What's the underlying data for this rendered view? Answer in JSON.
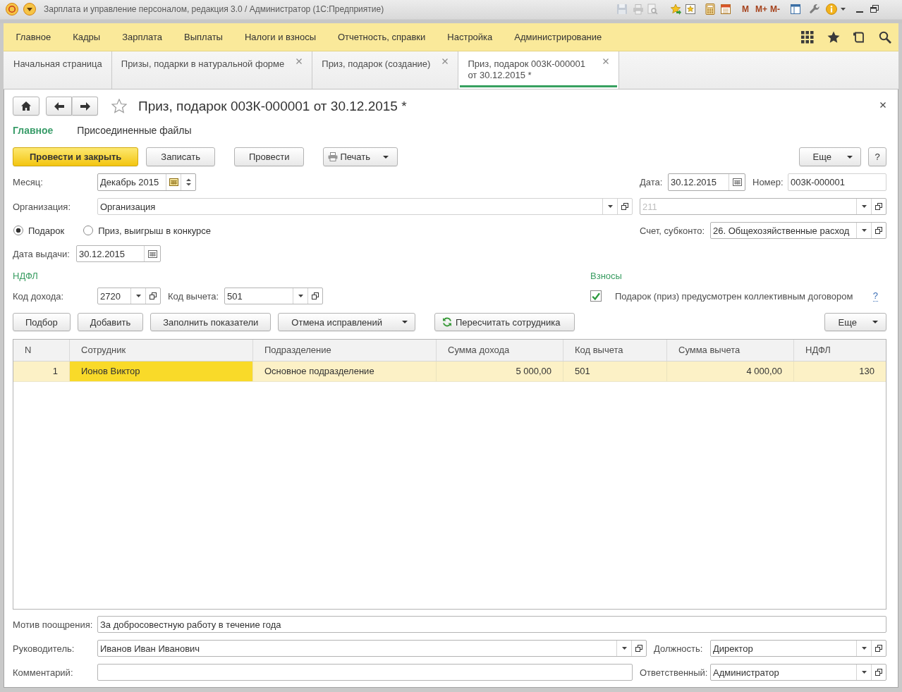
{
  "title_bar": {
    "title": "Зарплата и управление персоналом, редакция 3.0 / Администратор (1С:Предприятие)",
    "memory_buttons": [
      "M",
      "M+",
      "M-"
    ]
  },
  "main_menu": [
    "Главное",
    "Кадры",
    "Зарплата",
    "Выплаты",
    "Налоги и взносы",
    "Отчетность, справки",
    "Настройка",
    "Администрирование"
  ],
  "open_tabs": [
    {
      "label": "Начальная страница",
      "closable": false,
      "selected": false
    },
    {
      "label": "Призы, подарки в натуральной форме",
      "closable": true,
      "selected": false
    },
    {
      "label": "Приз, подарок (создание)",
      "closable": true,
      "selected": false
    },
    {
      "label": "Приз, подарок 003К-000001 от 30.12.2015 *",
      "closable": true,
      "selected": true
    }
  ],
  "form": {
    "title": "Приз, подарок 003К-000001 от 30.12.2015 *",
    "favorite": false,
    "sections": [
      {
        "label": "Главное",
        "selected": true
      },
      {
        "label": "Присоединенные файлы",
        "selected": false
      }
    ],
    "commands": [
      {
        "label": "Провести и закрыть",
        "kind": "default"
      },
      {
        "label": "Записать",
        "kind": "plain"
      },
      {
        "label": "Провести",
        "kind": "plain"
      },
      {
        "label": "Печать",
        "kind": "print"
      }
    ],
    "more_button": "Еще",
    "help_button": "?",
    "month": {
      "label": "Месяц:",
      "value": "Декабрь 2015"
    },
    "date": {
      "label": "Дата:",
      "value": "30.12.2015"
    },
    "number": {
      "label": "Номер:",
      "value": "003К-000001"
    },
    "organization": {
      "label": "Организация:",
      "value": "Организация"
    },
    "unlabeled_field": {
      "value": "211",
      "disabled": true
    },
    "gift_kind": [
      {
        "label": "Подарок",
        "selected": true
      },
      {
        "label": "Приз, выигрыш в конкурсе",
        "selected": false
      }
    ],
    "account": {
      "label": "Счет, субконто:",
      "value": "26. Общехозяйственные расход"
    },
    "issue_date": {
      "label": "Дата выдачи:",
      "value": "30.12.2015"
    },
    "ndfl": {
      "heading": "НДФЛ",
      "income_code": {
        "label": "Код дохода:",
        "value": "2720"
      },
      "deduction_code": {
        "label": "Код вычета:",
        "value": "501"
      }
    },
    "contributions": {
      "heading": "Взносы",
      "collective_agreement": {
        "label": "Подарок (приз) предусмотрен коллективным договором",
        "checked": true
      },
      "help_link": "?"
    },
    "table_toolbar": {
      "buttons": [
        {
          "label": "Подбор",
          "kind": "plain"
        },
        {
          "label": "Добавить",
          "kind": "plain"
        },
        {
          "label": "Заполнить показатели",
          "kind": "plain"
        },
        {
          "label": "Отмена исправлений",
          "kind": "menu"
        },
        {
          "label": "Пересчитать сотрудника",
          "kind": "refresh"
        }
      ],
      "more_button": "Еще"
    },
    "table": {
      "columns": [
        {
          "label": "N",
          "kind": "number"
        },
        {
          "label": "Сотрудник",
          "kind": "text"
        },
        {
          "label": "Подразделение",
          "kind": "text"
        },
        {
          "label": "Сумма дохода",
          "kind": "number"
        },
        {
          "label": "Код вычета",
          "kind": "text"
        },
        {
          "label": "Сумма вычета",
          "kind": "number"
        },
        {
          "label": "НДФЛ",
          "kind": "number"
        }
      ],
      "rows": [
        {
          "selected": true,
          "cells": [
            {
              "text": "1",
              "selected": false
            },
            {
              "text": "Ионов Виктор",
              "selected": true
            },
            {
              "text": "Основное подразделение",
              "selected": false
            },
            {
              "text": "5 000,00",
              "selected": false
            },
            {
              "text": "501",
              "selected": false
            },
            {
              "text": "4 000,00",
              "selected": false
            },
            {
              "text": "130",
              "selected": false
            }
          ]
        }
      ]
    },
    "motive": {
      "label": "Мотив поощрения:",
      "value": "За добросовестную работу в течение года"
    },
    "manager": {
      "label": "Руководитель:",
      "value": "Иванов Иван Иванович"
    },
    "position": {
      "label": "Должность:",
      "value": "Директор"
    },
    "comment": {
      "label": "Комментарий:"
    },
    "responsible": {
      "label": "Ответственный:",
      "value": "Администратор"
    }
  }
}
